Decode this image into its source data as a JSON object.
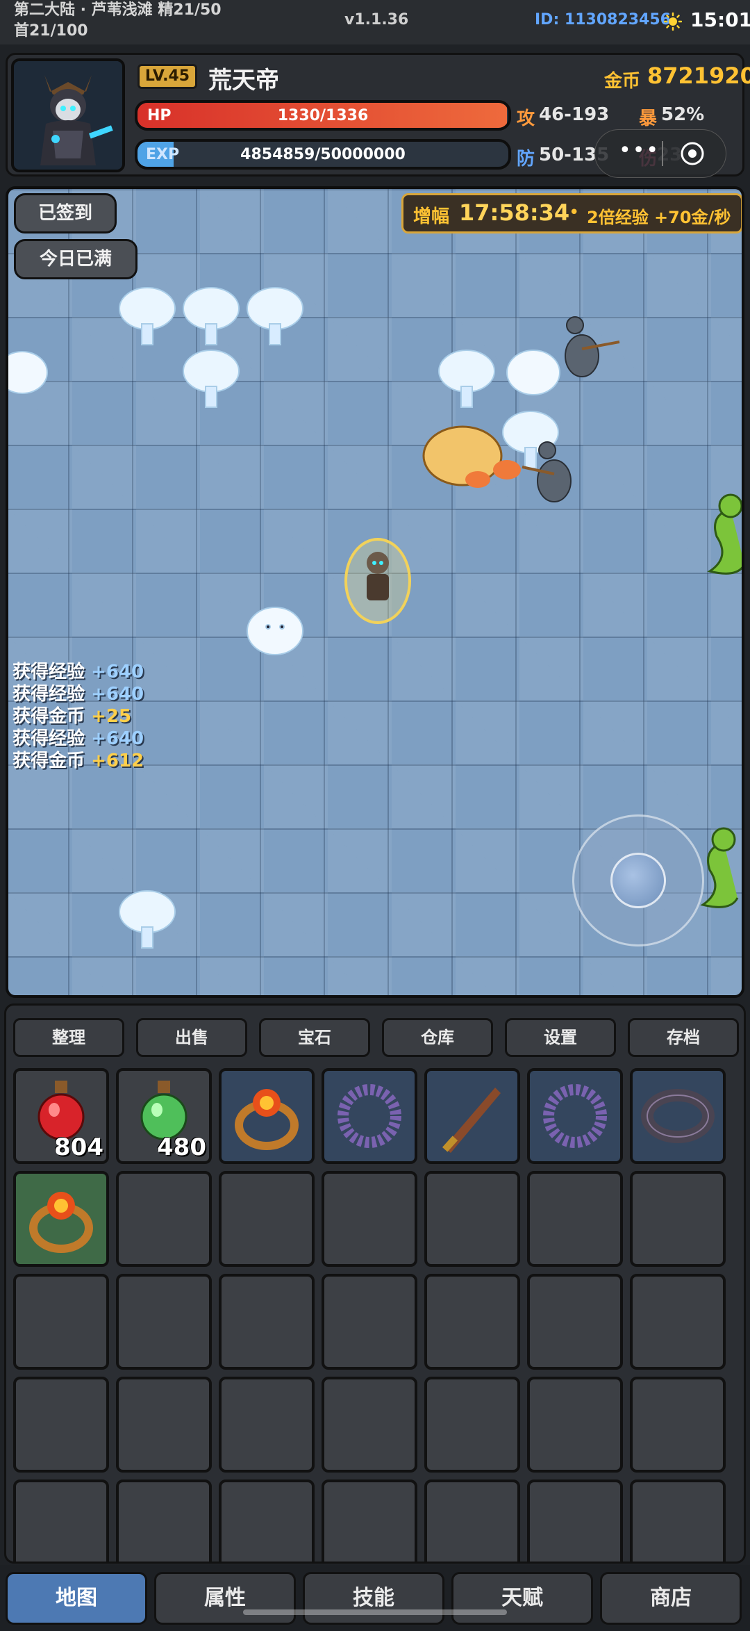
{
  "status": {
    "location_line1": "第二大陆 · 芦苇浅滩 精21/50",
    "location_line2": "首21/100",
    "version": "v1.1.36",
    "user_id": "ID: 1130823456",
    "time": "15:01"
  },
  "player": {
    "level": "LV.45",
    "name": "荒天帝",
    "gold_label": "金币",
    "gold": "8721920",
    "hp_label": "HP",
    "hp_text": "1330/1336",
    "hp_fraction": 0.9955,
    "exp_label": "EXP",
    "exp_text": "4854859/50000000",
    "exp_fraction": 0.097,
    "atk_label": "攻",
    "atk": "46-193",
    "crit_label": "暴",
    "crit": "52%",
    "def_label": "防",
    "def": "50-135",
    "dmg_label": "伤",
    "dmg": "23"
  },
  "map": {
    "signed_button": "已签到",
    "full_button": "今日已满",
    "boost_label": "增幅",
    "boost_timer": "17:58:34",
    "boost_dot": "•",
    "boost_text": "2倍经验 +70金/秒",
    "log": [
      {
        "text": "获得经验",
        "value": "+640",
        "kind": "exp"
      },
      {
        "text": "获得经验",
        "value": "+640",
        "kind": "exp"
      },
      {
        "text": "获得金币",
        "value": "+25",
        "kind": "gold"
      },
      {
        "text": "获得经验",
        "value": "+640",
        "kind": "exp"
      },
      {
        "text": "获得金币",
        "value": "+612",
        "kind": "gold"
      }
    ]
  },
  "inventory": {
    "tabs": [
      "整理",
      "出售",
      "宝石",
      "仓库",
      "设置",
      "存档"
    ],
    "items": [
      {
        "icon": "red-potion-icon",
        "count": "804"
      },
      {
        "icon": "green-potion-icon",
        "count": "480"
      },
      {
        "icon": "fire-ring-icon"
      },
      {
        "icon": "thorn-ring-icon"
      },
      {
        "icon": "dagger-icon"
      },
      {
        "icon": "thorn-ring-icon"
      },
      {
        "icon": "dark-bracelet-icon"
      },
      {
        "icon": "fire-ring-icon"
      }
    ]
  },
  "nav": {
    "items": [
      "地图",
      "属性",
      "技能",
      "天赋",
      "商店"
    ],
    "active": 0
  },
  "colors": {
    "gold": "#ffc233",
    "hp": "#e0402e",
    "exp": "#4fa3e6",
    "active_tab": "#4d79b3",
    "map": "#7e9fc2"
  }
}
